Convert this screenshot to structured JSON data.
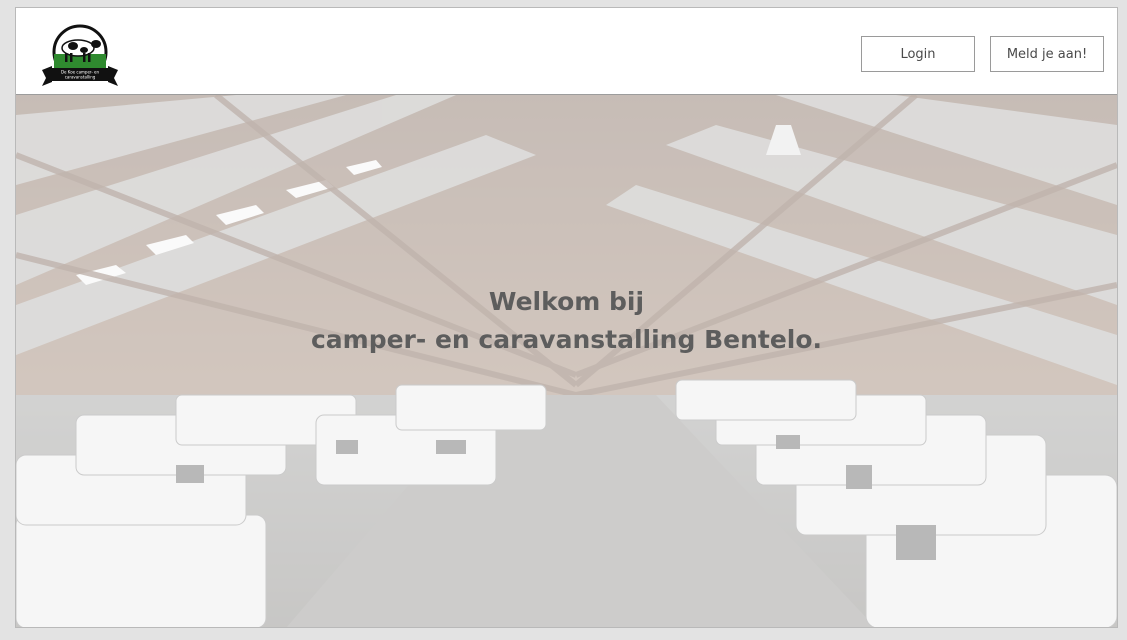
{
  "header": {
    "logo_text_line1": "De Koe camper- en",
    "logo_text_line2": "caravanstalling",
    "login_label": "Login",
    "signup_label": "Meld je aan!"
  },
  "hero": {
    "title_line1": "Welkom bij",
    "title_line2": "camper- en caravanstalling Bentelo."
  },
  "colors": {
    "page_bg": "#e3e3e3",
    "hero_text": "#5d5d5d",
    "button_border": "#9a9a9a"
  }
}
